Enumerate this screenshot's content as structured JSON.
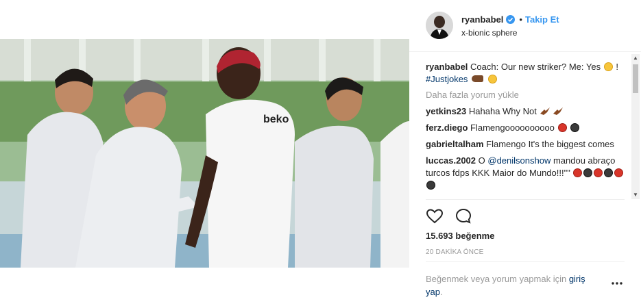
{
  "post": {
    "username": "ryanbabel",
    "follow_label": "Takip Et",
    "dot": "•",
    "location": "x-bionic sphere",
    "photo_jersey_text": "beko"
  },
  "comments": [
    {
      "user": "ryanbabel",
      "text": "Coach: Our new striker? Me: Yes",
      "text2": "! ",
      "hashtag": "#Justjokes"
    },
    {
      "user": "yetkins23",
      "text": "Hahaha Why Not"
    },
    {
      "user": "ferz.diego",
      "text": "Flamengoooooooooo"
    },
    {
      "user": "gabrieltalham",
      "text": "Flamengo It's the biggest comes"
    },
    {
      "user": "luccas.2002",
      "text_before": "O ",
      "mention": "@denilsonshow",
      "text": " mandou abraço turcos fdps KKK Maior do Mundo!!!\"\""
    }
  ],
  "load_more": "Daha fazla yorum yükle",
  "likes": "15.693 beğenme",
  "time_ago": "20 DAKİKA ÖNCE",
  "login_note": {
    "text": "Beğenmek veya yorum yapmak için ",
    "link": "giriş yap",
    "suffix": "."
  },
  "colors": {
    "link_blue": "#3897f0",
    "text": "#262626",
    "muted": "#999999"
  },
  "icons": [
    "verified-badge-icon",
    "heart-icon",
    "comment-icon",
    "more-options-icon"
  ]
}
